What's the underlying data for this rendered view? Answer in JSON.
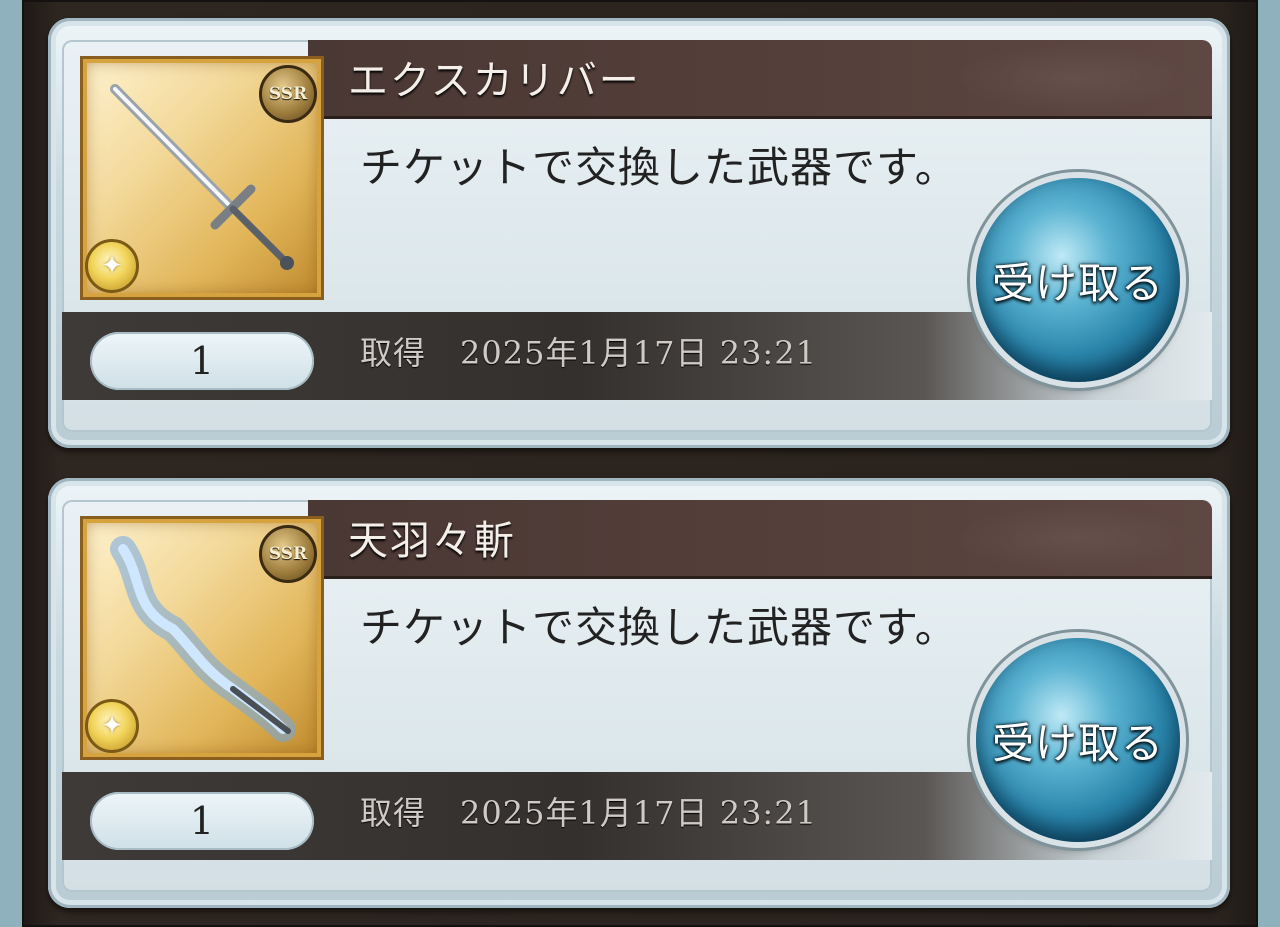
{
  "items": [
    {
      "title": "エクスカリバー",
      "description": "チケットで交換した武器です。",
      "rarity": "SSR",
      "element_icon": "light-element-icon",
      "weapon_icon": "sword-icon",
      "quantity": "1",
      "obtained_label": "取得",
      "obtained_date": "2025年1月17日 23:21",
      "receive_label": "受け取る"
    },
    {
      "title": "天羽々斬",
      "description": "チケットで交換した武器です。",
      "rarity": "SSR",
      "element_icon": "light-element-icon",
      "weapon_icon": "blue-flame-sword-icon",
      "quantity": "1",
      "obtained_label": "取得",
      "obtained_date": "2025年1月17日 23:21",
      "receive_label": "受け取る"
    }
  ],
  "colors": {
    "title_bar": "#553f3a",
    "button_blue": "#2a85ab",
    "thumb_gold": "#e2b65a"
  }
}
